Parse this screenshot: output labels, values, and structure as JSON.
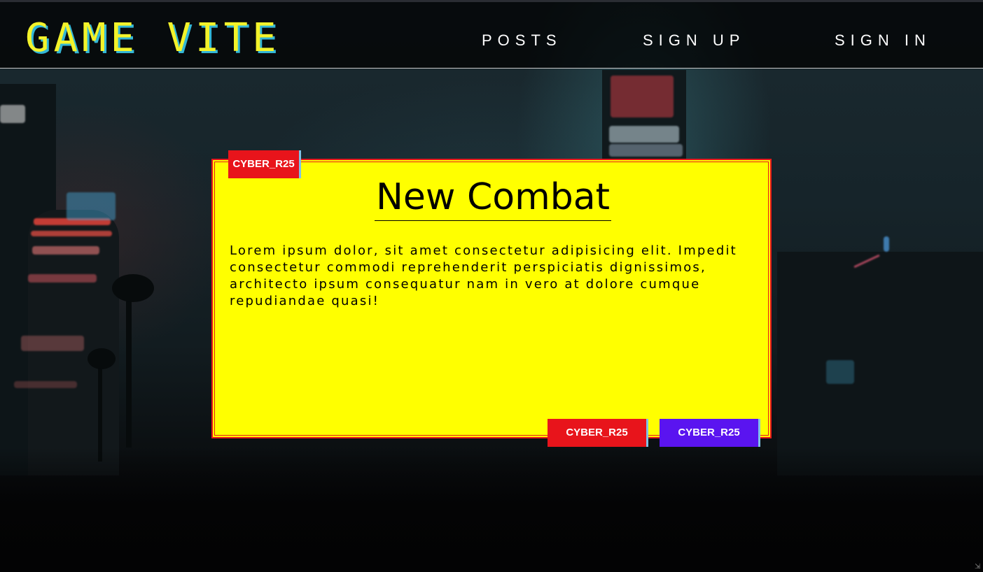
{
  "header": {
    "logo": "GAME VITE",
    "nav": {
      "posts": "POSTS",
      "sign_up": "SIGN UP",
      "sign_in": "SIGN IN"
    }
  },
  "card": {
    "title": "New Combat",
    "body": "Lorem ipsum dolor, sit amet consectetur adipisicing elit. Impedit consectetur commodi reprehenderit perspiciatis dignissimos, architecto ipsum consequatur nam in vero at dolore cumque repudiandae quasi!",
    "tag_top": "CYBER_R25",
    "tag_red": "CYBER_R25",
    "tag_purple": "CYBER_R25"
  },
  "colors": {
    "logo": "#f3f32a",
    "logo_shadow": "#33b6d6",
    "card_background": "#ffff00",
    "card_border": "#e8171b",
    "tag_red": "#e8141b",
    "tag_purple": "#5a14f0"
  },
  "icons": {
    "resize_grip": "resize-grip-icon"
  }
}
